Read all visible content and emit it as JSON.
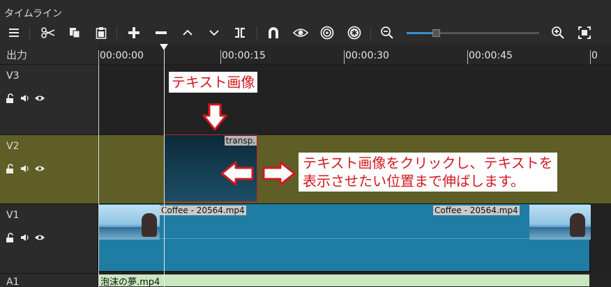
{
  "panel": {
    "title": "タイムライン"
  },
  "toolbar": {
    "icons": [
      "menu-icon",
      "cut-icon",
      "copy-icon",
      "paste-icon",
      "add-icon",
      "remove-icon",
      "lift-up-icon",
      "overwrite-down-icon",
      "split-icon",
      "snap-magnet-icon",
      "scrub-eye-icon",
      "ripple-icon",
      "ripple-all-icon",
      "zoom-out-icon",
      "zoom-in-icon",
      "zoom-fit-icon"
    ],
    "zoom_level": 0.22
  },
  "ruler": {
    "header": "出力",
    "labels": [
      "00:00:00",
      "00:00:15",
      "00:00:30",
      "00:00:45",
      "0"
    ]
  },
  "tracks": [
    {
      "name": "V3"
    },
    {
      "name": "V2"
    },
    {
      "name": "V1"
    },
    {
      "name": "A1"
    }
  ],
  "clips": {
    "transp": "transp.",
    "video_left": "Coffee - 20564.mp4",
    "video_right": "Coffee - 20564.mp4",
    "audio": "泡沫の夢.mp4"
  },
  "annotations": {
    "text1": "テキスト画像",
    "text2_line1": "テキスト画像をクリックし、テキストを",
    "text2_line2": "表示させたい位置まで伸ばします。"
  },
  "colors": {
    "accent": "#3a8fd0",
    "v2_track": "#5e5e26",
    "video_clip": "#1f7ca2",
    "audio_clip": "#c9e8c0",
    "annotation_red": "#d2181f"
  }
}
